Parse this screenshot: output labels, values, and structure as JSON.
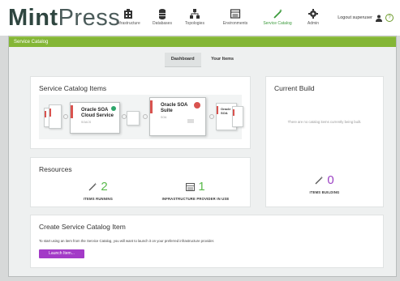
{
  "brand": {
    "part1": "Mint",
    "part2": "Press"
  },
  "nav": [
    {
      "label": "Infrastructure",
      "icon": "building-icon"
    },
    {
      "label": "Databases",
      "icon": "database-icon"
    },
    {
      "label": "Topologies",
      "icon": "topology-icon"
    },
    {
      "label": "Environments",
      "icon": "server-icon"
    },
    {
      "label": "Service Catalog",
      "icon": "wand-icon",
      "active": true
    },
    {
      "label": "Admin",
      "icon": "gear-icon"
    }
  ],
  "user": {
    "label": "Logout superuser",
    "help": "?"
  },
  "window_title": "Service Catalog",
  "tabs": [
    {
      "label": "Dashboard",
      "active": true
    },
    {
      "label": "Your Items"
    }
  ],
  "catalog_items": {
    "title": "Service Catalog Items",
    "card1": {
      "title_line1": "Oracle SOA",
      "title_line2": "Cloud Service",
      "subtitle": "SOACS"
    },
    "card2": {
      "title_line1": "Oracle SOA",
      "title_line2": "Suite",
      "subtitle": "SOA"
    },
    "card3": {
      "title_line1": "Oracle",
      "title_line2": "SOA"
    }
  },
  "current_build": {
    "title": "Current Build",
    "empty_text": "There are no catalog items currently being built."
  },
  "resources": {
    "title": "Resources",
    "running": {
      "count": "2",
      "label": "ITEMS RUNNING"
    },
    "infra": {
      "count": "1",
      "label": "INFRASTRUCTURE PROVIDER IN USE"
    },
    "building": {
      "count": "0",
      "label": "ITEMS BUILDING"
    }
  },
  "create": {
    "title": "Create Service Catalog Item",
    "text": "To start using an item from the Service Catalog, you will want to launch it on your preferred infrastructure provider.",
    "button": "Launch Item..."
  },
  "colors": {
    "accent_green": "#84b636",
    "count_green": "#59b94b",
    "purple": "#a33ac7"
  }
}
